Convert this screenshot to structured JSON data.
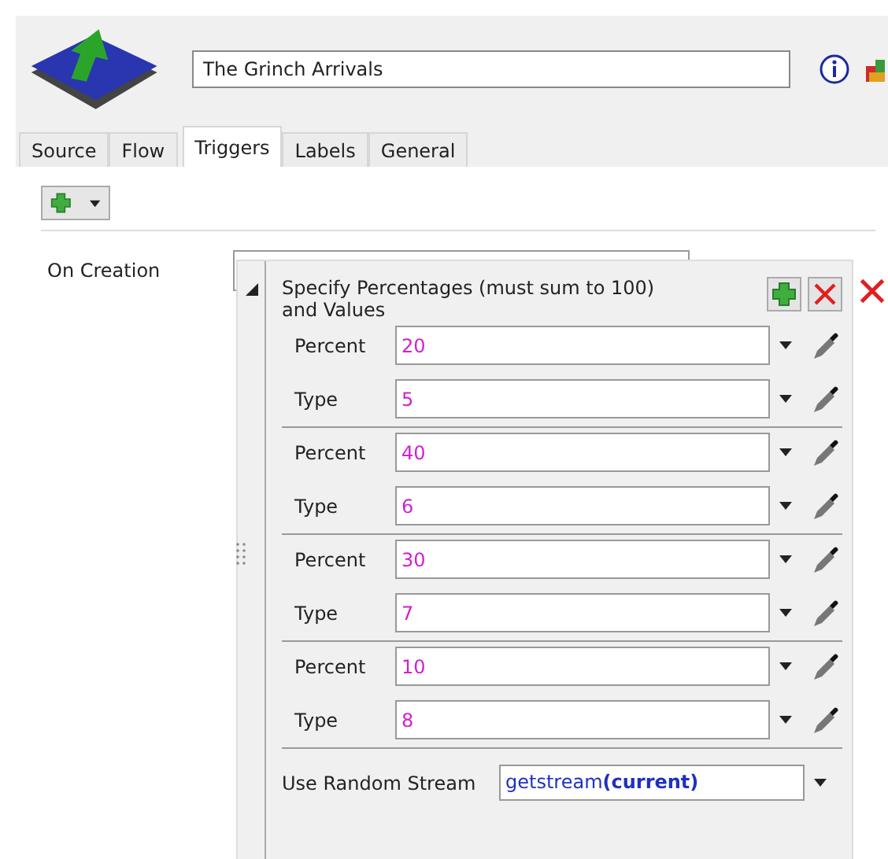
{
  "name_field": {
    "value": "The Grinch Arrivals"
  },
  "tabs": [
    {
      "label": "Source",
      "selected": false
    },
    {
      "label": "Flow",
      "selected": false
    },
    {
      "label": "Triggers",
      "selected": true
    },
    {
      "label": "Labels",
      "selected": false
    },
    {
      "label": "General",
      "selected": false
    }
  ],
  "trigger": {
    "label": "On Creation"
  },
  "popup": {
    "title": "Specify Percentages (must sum to 100) and Values",
    "entries": [
      {
        "percent_label": "Percent",
        "percent": "20",
        "type_label": "Type",
        "type": "5"
      },
      {
        "percent_label": "Percent",
        "percent": "40",
        "type_label": "Type",
        "type": "6"
      },
      {
        "percent_label": "Percent",
        "percent": "30",
        "type_label": "Type",
        "type": "7"
      },
      {
        "percent_label": "Percent",
        "percent": "10",
        "type_label": "Type",
        "type": "8"
      }
    ],
    "stream_label": "Use Random Stream",
    "stream_value": "getstream**(current)**"
  }
}
